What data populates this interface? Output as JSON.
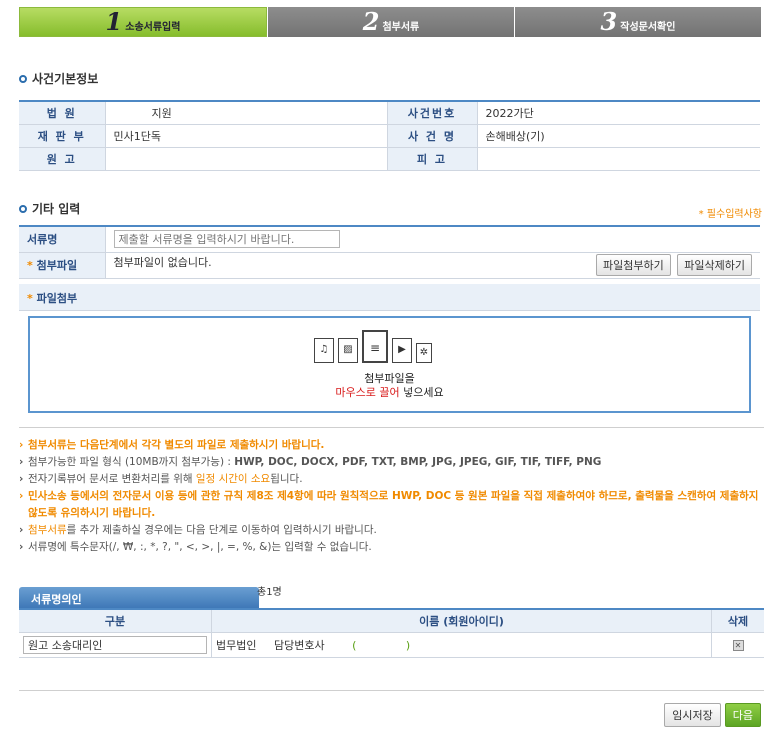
{
  "steps": [
    {
      "num": "1",
      "label": "소송서류입력"
    },
    {
      "num": "2",
      "label": "첨부서류"
    },
    {
      "num": "3",
      "label": "작성문서확인"
    }
  ],
  "case_info": {
    "title": "사건기본정보",
    "court_label": "법 원",
    "court_value": "지원",
    "case_no_label": "사건번호",
    "case_no_value": "2022가단",
    "division_label": "재 판 부",
    "division_value": "민사1단독",
    "case_name_label": "사 건 명",
    "case_name_value": "손해배상(기)",
    "plaintiff_label": "원 고",
    "plaintiff_value": "",
    "defendant_label": "피 고",
    "defendant_value": ""
  },
  "etc": {
    "title": "기타 입력",
    "required_note": "* 필수입력사항",
    "doc_name_label": "서류명",
    "doc_name_placeholder": "제출할 서류명을 입력하시기 바랍니다.",
    "attach_label": "첨부파일",
    "attach_status": "첨부파일이 없습니다.",
    "attach_button": "파일첨부하기",
    "delete_button": "파일삭제하기",
    "upload_label": "파일첨부",
    "drop_line1": "첨부파일을",
    "drop_red": "마우스로 끌어",
    "drop_line2": " 넣으세요"
  },
  "notes": {
    "n1": "첨부서류는 다음단계에서 각각 별도의 파일로 제출하시기 바랍니다.",
    "n2a": "첨부가능한 파일 형식 (10MB까지 첨부가능) : ",
    "n2b": "HWP, DOC, DOCX, PDF, TXT, BMP, JPG, JPEG, GIF, TIF, TIFF, PNG",
    "n3a": "전자기록뷰어 문서로 변환처리를 위해 ",
    "n3b": "일정 시간이 소요",
    "n3c": "됩니다.",
    "n4": "민사소송 등에서의 전자문서 이용 등에 관한 규칙 제8조 제4항에 따라 원칙적으로 HWP, DOC 등 원본 파일을 직접 제출하여야 하므로, 출력물을 스캔하여 제출하지 않도록 유의하시기 바랍니다.",
    "n5a": "첨부서류",
    "n5b": "를 추가 제출하실 경우에는 다음 단계로 이동하여 입력하시기 바랍니다.",
    "n6": "서류명에 특수문자(/, ₩, :, *, ?, \", <, >, |, =, %, &)는 입력할 수 없습니다."
  },
  "nominee": {
    "tab_label": "서류명의인",
    "count": "총1명",
    "col_type": "구분",
    "col_name": "이름 (회원아이디)",
    "col_delete": "삭제",
    "row_type": "원고 소송대리인",
    "row_firm": "법무법인",
    "row_lawyer": "담당변호사",
    "row_open": "(",
    "row_close": ")"
  },
  "buttons": {
    "temp_save": "임시저장",
    "next": "다음"
  }
}
